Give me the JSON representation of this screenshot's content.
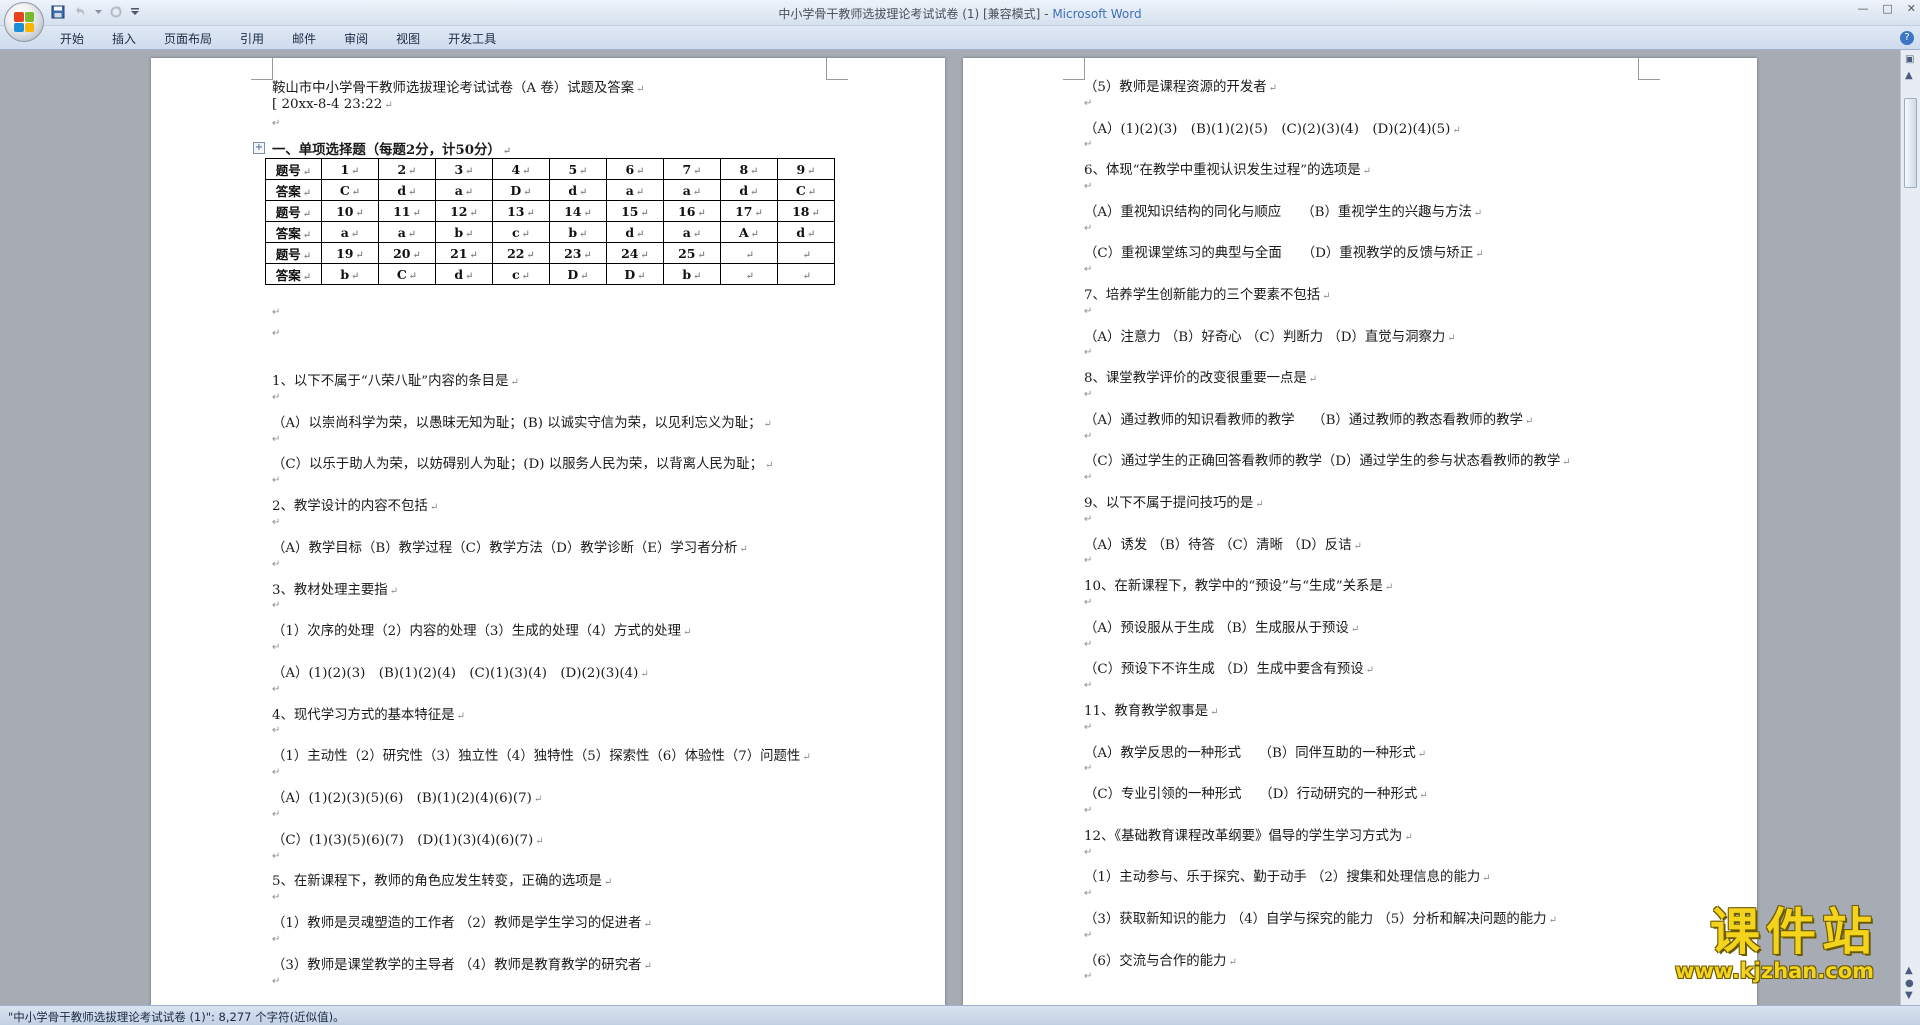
{
  "window": {
    "title_doc": "中小学骨干教师选拔理论考试试卷 (1) [兼容模式] - ",
    "title_app": "Microsoft Word",
    "min": "—",
    "max": "□",
    "close": "✕"
  },
  "ribbon": {
    "tabs": [
      "开始",
      "插入",
      "页面布局",
      "引用",
      "邮件",
      "审阅",
      "视图",
      "开发工具"
    ],
    "help": "?"
  },
  "qat": {
    "save_icon": "save-icon",
    "undo_icon": "undo-icon",
    "redo_icon": "redo-icon",
    "customize_icon": "chevron-down-icon"
  },
  "statusbar": {
    "text": "\"中小学骨干教师选拔理论考试试卷 (1)\": 8,277 个字符(近似值)。"
  },
  "left_page": {
    "doc_title": "鞍山市中小学骨干教师选拔理论考试试卷（A 卷）试题及答案",
    "date": "[ 20xx-8-4 23:22",
    "section1": "一、单项选择题（每题2分，计50分）",
    "table": [
      [
        "题号",
        "1",
        "2",
        "3",
        "4",
        "5",
        "6",
        "7",
        "8",
        "9"
      ],
      [
        "答案",
        "C",
        "d",
        "a",
        "D",
        "d",
        "a",
        "a",
        "d",
        "C"
      ],
      [
        "题号",
        "10",
        "11",
        "12",
        "13",
        "14",
        "15",
        "16",
        "17",
        "18"
      ],
      [
        "答案",
        "a",
        "a",
        "b",
        "c",
        "b",
        "d",
        "a",
        "A",
        "d"
      ],
      [
        "题号",
        "19",
        "20",
        "21",
        "22",
        "23",
        "24",
        "25",
        "",
        ""
      ],
      [
        "答案",
        "b",
        "C",
        "d",
        "c",
        "D",
        "D",
        "b",
        "",
        ""
      ]
    ],
    "lines": [
      "1、以下不属于“八荣八耻”内容的条目是",
      "（A）以崇尚科学为荣，以愚昧无知为耻；(B) 以诚实守信为荣，以见利忘义为耻；",
      "（C）以乐于助人为荣，以妨碍别人为耻；(D) 以服务人民为荣，以背离人民为耻；",
      "2、教学设计的内容不包括",
      "（A）教学目标（B）教学过程（C）教学方法（D）教学诊断（E）学习者分析",
      "3、教材处理主要指",
      "（1）次序的处理（2）内容的处理（3）生成的处理（4）方式的处理",
      "（A）(1)(2)(3)　(B)(1)(2)(4)　(C)(1)(3)(4)　(D)(2)(3)(4)",
      "4、现代学习方式的基本特征是",
      "（1）主动性（2）研究性（3）独立性（4）独特性（5）探索性（6）体验性（7）问题性",
      "（A）(1)(2)(3)(5)(6)　(B)(1)(2)(4)(6)(7)",
      "（C）(1)(3)(5)(6)(7)　(D)(1)(3)(4)(6)(7)",
      "5、在新课程下，教师的角色应发生转变，正确的选项是",
      "（1）教师是灵魂塑造的工作者 （2）教师是学生学习的促进者",
      "（3）教师是课堂教学的主导者 （4）教师是教育教学的研究者"
    ]
  },
  "right_page": {
    "lines": [
      "（5）教师是课程资源的开发者",
      "（A）(1)(2)(3)　(B)(1)(2)(5)　(C)(2)(3)(4)　(D)(2)(4)(5)",
      "6、体现“在教学中重视认识发生过程”的选项是",
      "（A）重视知识结构的同化与顺应　　（B）重视学生的兴趣与方法",
      "（C）重视课堂练习的典型与全面　　（D）重视教学的反馈与矫正",
      "7、培养学生创新能力的三个要素不包括",
      "（A）注意力 （B）好奇心 （C）判断力 （D）直觉与洞察力",
      "8、课堂教学评价的改变很重要一点是",
      "（A）通过教师的知识看教师的教学　 （B）通过教师的教态看教师的教学",
      "（C）通过学生的正确回答看教师的教学（D）通过学生的参与状态看教师的教学",
      "9、以下不属于提问技巧的是",
      "（A）诱发 （B）待答 （C）清晰 （D）反诘",
      "10、在新课程下，教学中的“预设”与“生成”关系是",
      "（A）预设服从于生成 （B）生成服从于预设",
      "（C）预设下不许生成 （D）生成中要含有预设",
      "11、教育教学叙事是",
      "（A）教学反思的一种形式　 （B）同伴互助的一种形式",
      "（C）专业引领的一种形式　 （D）行动研究的一种形式",
      "12、《基础教育课程改革纲要》倡导的学生学习方式为",
      "（1）主动参与、乐于探究、勤于动手 （2）搜集和处理信息的能力",
      "（3）获取新知识的能力 （4）自学与探究的能力 （5）分析和解决问题的能力",
      "（6）交流与合作的能力"
    ]
  },
  "watermark": {
    "big": "课件站",
    "url": "www.kjzhan.com"
  },
  "marks": {
    "para": "↵",
    "anchor": "+"
  }
}
